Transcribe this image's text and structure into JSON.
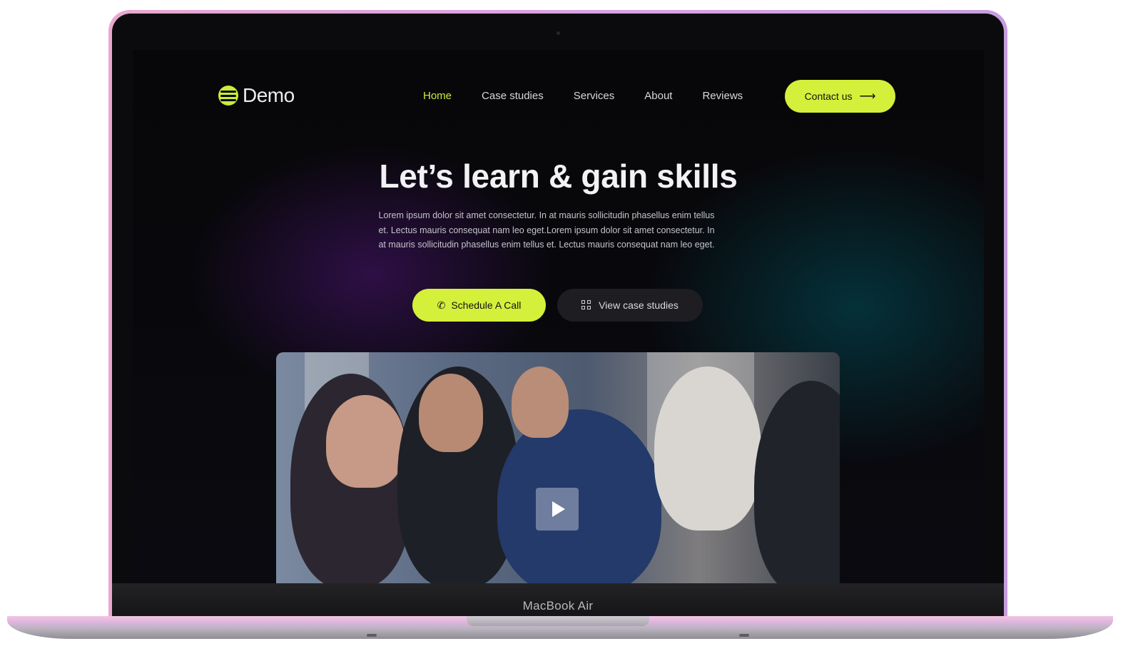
{
  "device": {
    "label": "MacBook Air"
  },
  "site": {
    "logo_text": "Demo",
    "nav": [
      "Home",
      "Case studies",
      "Services",
      "About",
      "Reviews"
    ],
    "active_nav": "Home",
    "contact_label": "Contact us",
    "contact_arrow": "⟶",
    "colors": {
      "accent": "#d4f03a",
      "background": "#08080b",
      "text": "#f2f2f5"
    }
  },
  "hero": {
    "title": "Let’s learn & gain skills",
    "body": "Lorem ipsum dolor sit amet consectetur. In at mauris sollicitudin phasellus enim tellus et. Lectus mauris consequat nam leo eget.Lorem ipsum dolor sit amet consectetur. In at mauris sollicitudin phasellus enim tellus et. Lectus mauris consequat nam leo eget.",
    "primary_button": "Schedule A Call",
    "primary_icon": "✆",
    "secondary_button": "View case studies"
  },
  "video": {
    "icon": "play-icon"
  }
}
